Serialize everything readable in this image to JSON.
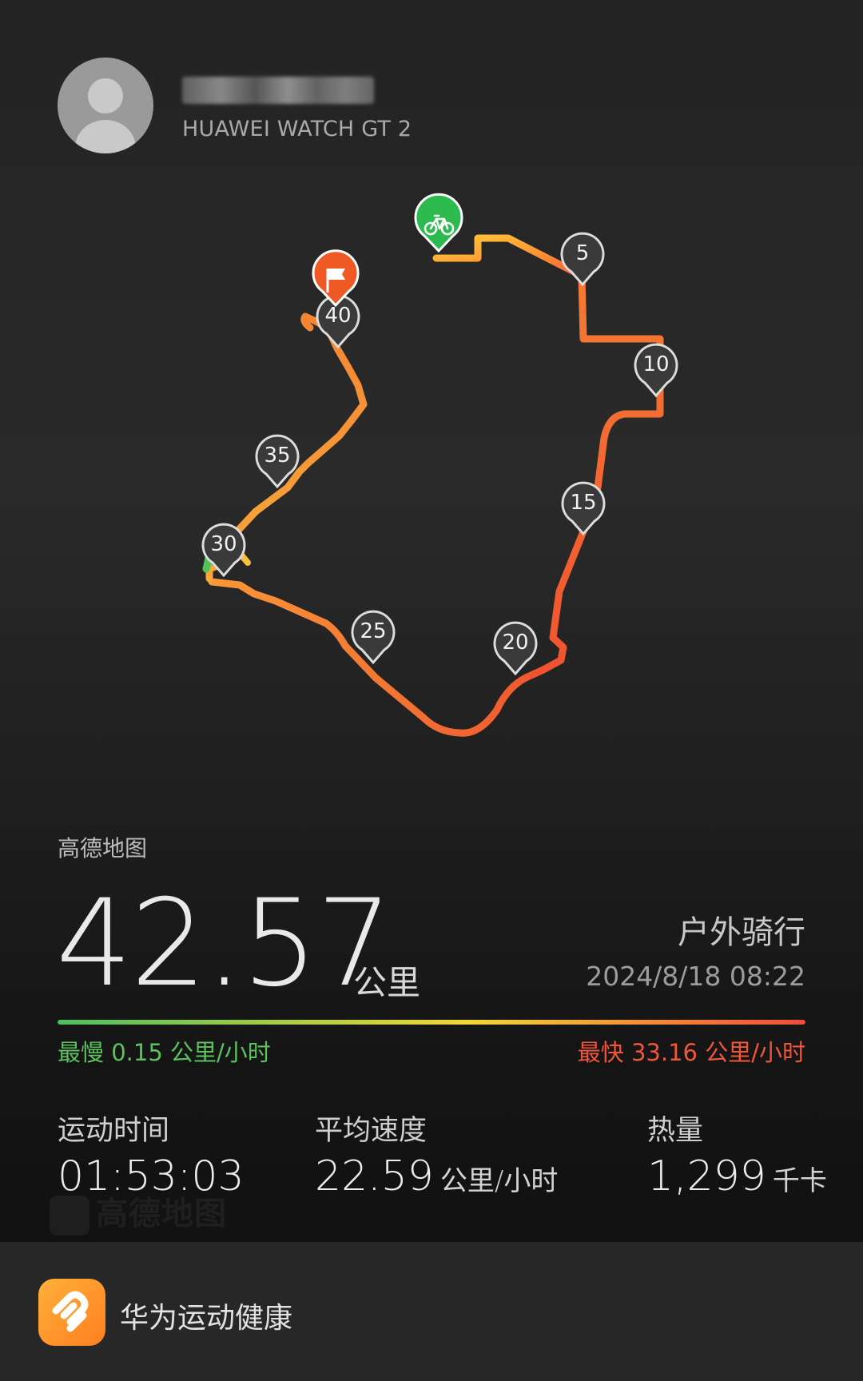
{
  "header": {
    "device_name": "HUAWEI WATCH GT 2"
  },
  "map": {
    "source_label": "高德地图",
    "km_markers": [
      "5",
      "10",
      "15",
      "20",
      "25",
      "30",
      "35",
      "40"
    ],
    "start_marker": "bicycle-icon",
    "end_marker": "flag-icon",
    "colors": {
      "start_marker": "#2dbb4f",
      "end_marker": "#ef5a24",
      "route_slow": "#ffd84a",
      "route_mid": "#ff9a2e",
      "route_fast": "#f04e2c"
    }
  },
  "summary": {
    "distance": "42.57",
    "distance_unit": "公里",
    "activity_type": "户外骑行",
    "datetime": "2024/8/18 08:22"
  },
  "speed_range": {
    "slowest_label": "最慢",
    "slowest_value": "0.15 公里/小时",
    "fastest_label": "最快",
    "fastest_value": "33.16 公里/小时",
    "slow_color": "#5cc15f",
    "fast_color": "#f1553a"
  },
  "stats": {
    "duration_label": "运动时间",
    "duration_value": "01:53:03",
    "avg_speed_label": "平均速度",
    "avg_speed_value": "22.59",
    "avg_speed_unit": "公里/小时",
    "calories_label": "热量",
    "calories_value": "1,299",
    "calories_unit": "千卡"
  },
  "watermark": {
    "text": "高德地图"
  },
  "footer": {
    "app_name": "华为运动健康",
    "app_icon": "huawei-health-icon",
    "app_icon_color": "#ff8f26"
  }
}
